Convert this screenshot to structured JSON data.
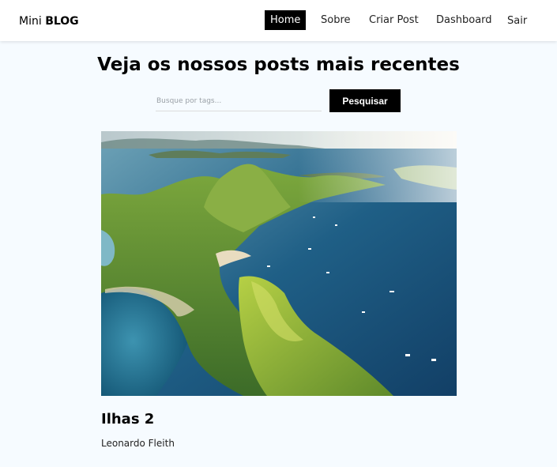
{
  "brand": {
    "light": "Mini",
    "bold": "BLOG"
  },
  "nav": {
    "items": [
      {
        "label": "Home",
        "active": true
      },
      {
        "label": "Sobre",
        "active": false
      },
      {
        "label": "Criar Post",
        "active": false
      },
      {
        "label": "Dashboard",
        "active": false
      },
      {
        "label": "Sair",
        "active": false
      }
    ]
  },
  "main": {
    "heading": "Veja os nossos posts mais recentes",
    "search": {
      "placeholder": "Busque por tags...",
      "value": "",
      "button_label": "Pesquisar"
    }
  },
  "posts": [
    {
      "title": "Ilhas 2",
      "author": "Leonardo Fleith",
      "image": "aerial-islands-photo"
    }
  ],
  "colors": {
    "page_bg": "#f6fbff",
    "navbar_bg": "#ffffff",
    "accent": "#000000"
  }
}
